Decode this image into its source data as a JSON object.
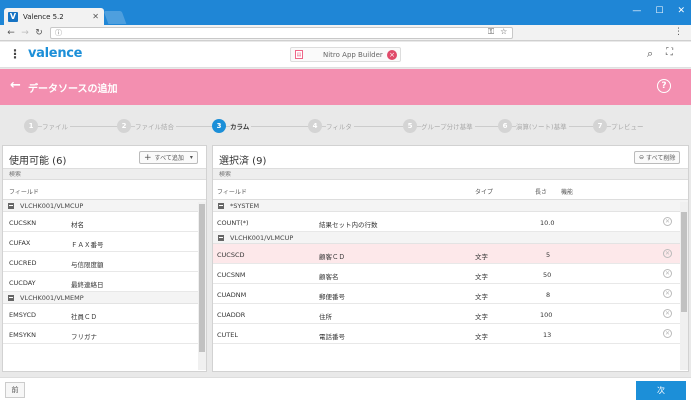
{
  "browser": {
    "tab_title": "Valence 5.2",
    "tab_logo": "V",
    "url": "",
    "icons": {
      "back": "arrow-left",
      "forward": "arrow-right",
      "reload": "reload",
      "key": "key",
      "star": "star",
      "menu": "menu-dots"
    }
  },
  "app": {
    "brand": "valence",
    "chip_label": "Nitro App Builder",
    "chip_close": "×"
  },
  "page": {
    "title": "データソースの追加",
    "help": "?"
  },
  "steps": [
    {
      "num": "1",
      "label": "ファイル",
      "active": false
    },
    {
      "num": "2",
      "label": "ファイル結合",
      "active": false
    },
    {
      "num": "3",
      "label": "カラム",
      "active": true
    },
    {
      "num": "4",
      "label": "フィルタ",
      "active": false
    },
    {
      "num": "5",
      "label": "グループ分け基準",
      "active": false
    },
    {
      "num": "6",
      "label": "演算(ソート)基準",
      "active": false
    },
    {
      "num": "7",
      "label": "プレビュー",
      "active": false
    }
  ],
  "available": {
    "title": "使用可能 (6)",
    "add_all": "すべて追加",
    "search_placeholder": "検索",
    "col_field": "フィールド",
    "groups": [
      {
        "name": "VLCHK001/VLMCUP",
        "rows": [
          {
            "field": "CUCSKN",
            "desc": "材名"
          },
          {
            "field": "CUFAX",
            "desc": "ＦＡＸ番号"
          },
          {
            "field": "CUCRED",
            "desc": "与信限度額"
          },
          {
            "field": "CUCDAY",
            "desc": "最終連絡日"
          }
        ]
      },
      {
        "name": "VLCHK001/VLMEMP",
        "rows": [
          {
            "field": "EMSYCD",
            "desc": "社員ＣＤ"
          },
          {
            "field": "EMSYKN",
            "desc": "フリガナ"
          }
        ]
      }
    ]
  },
  "selected": {
    "title": "選択済 (9)",
    "remove_all": "すべて削除",
    "search_placeholder": "検索",
    "col_field": "フィールド",
    "col_type": "タイプ",
    "col_length": "長さ",
    "col_function": "機能",
    "groups": [
      {
        "name": "*SYSTEM",
        "rows": [
          {
            "field": "COUNT(*)",
            "desc": "結果セット内の行数",
            "type": "",
            "length": "10.0",
            "selected": false
          }
        ]
      },
      {
        "name": "VLCHK001/VLMCUP",
        "rows": [
          {
            "field": "CUCSCD",
            "desc": "顧客ＣＤ",
            "type": "文字",
            "length": "5",
            "selected": true
          },
          {
            "field": "CUCSNM",
            "desc": "顧客名",
            "type": "文字",
            "length": "50",
            "selected": false
          },
          {
            "field": "CUADNM",
            "desc": "郵便番号",
            "type": "文字",
            "length": "8",
            "selected": false
          },
          {
            "field": "CUADDR",
            "desc": "住所",
            "type": "文字",
            "length": "100",
            "selected": false
          },
          {
            "field": "CUTEL",
            "desc": "電話番号",
            "type": "文字",
            "length": "13",
            "selected": false
          }
        ]
      }
    ]
  },
  "footer": {
    "prev": "前",
    "next": "次"
  },
  "colors": {
    "accent": "#1c8fd8",
    "band": "#f38fb0",
    "selected_row": "#fde8ea"
  }
}
